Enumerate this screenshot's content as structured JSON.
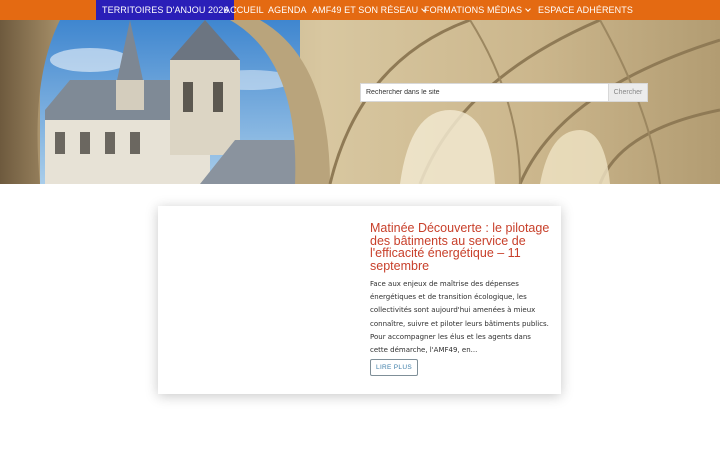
{
  "nav": {
    "items": [
      {
        "label": "TERRITOIRES D'ANJOU 2026",
        "highlight": true
      },
      {
        "label": "ACCUEIL"
      },
      {
        "label": "AGENDA"
      },
      {
        "label": "AMF49 ET SON RÉSEAU",
        "icon": "chevron-down-icon"
      },
      {
        "label": "FORMATIONS"
      },
      {
        "label": "MÉDIAS",
        "icon": "chevron-down-icon"
      },
      {
        "label": "ESPACE ADHÉRENTS"
      }
    ]
  },
  "search": {
    "placeholder": "Rechercher dans le site",
    "button_label": "Chercher"
  },
  "article": {
    "title": "Matinée Découverte : le pilotage des bâtiments au service de l'efficacité énergétique – 11 septembre",
    "excerpt": "Face aux enjeux de maîtrise des dépenses énergétiques et de transition écologique, les collectivités sont aujourd'hui amenées à mieux connaître, suivre et piloter leurs bâtiments publics. Pour accompagner les élus et les agents dans cette démarche, l'AMF49, en...",
    "read_more_label": "LIRE PLUS"
  },
  "colors": {
    "nav_background": "#e46a12",
    "nav_highlight": "#2a1fb8",
    "title_color": "#c8402b",
    "button_text": "#3e7ea8"
  }
}
